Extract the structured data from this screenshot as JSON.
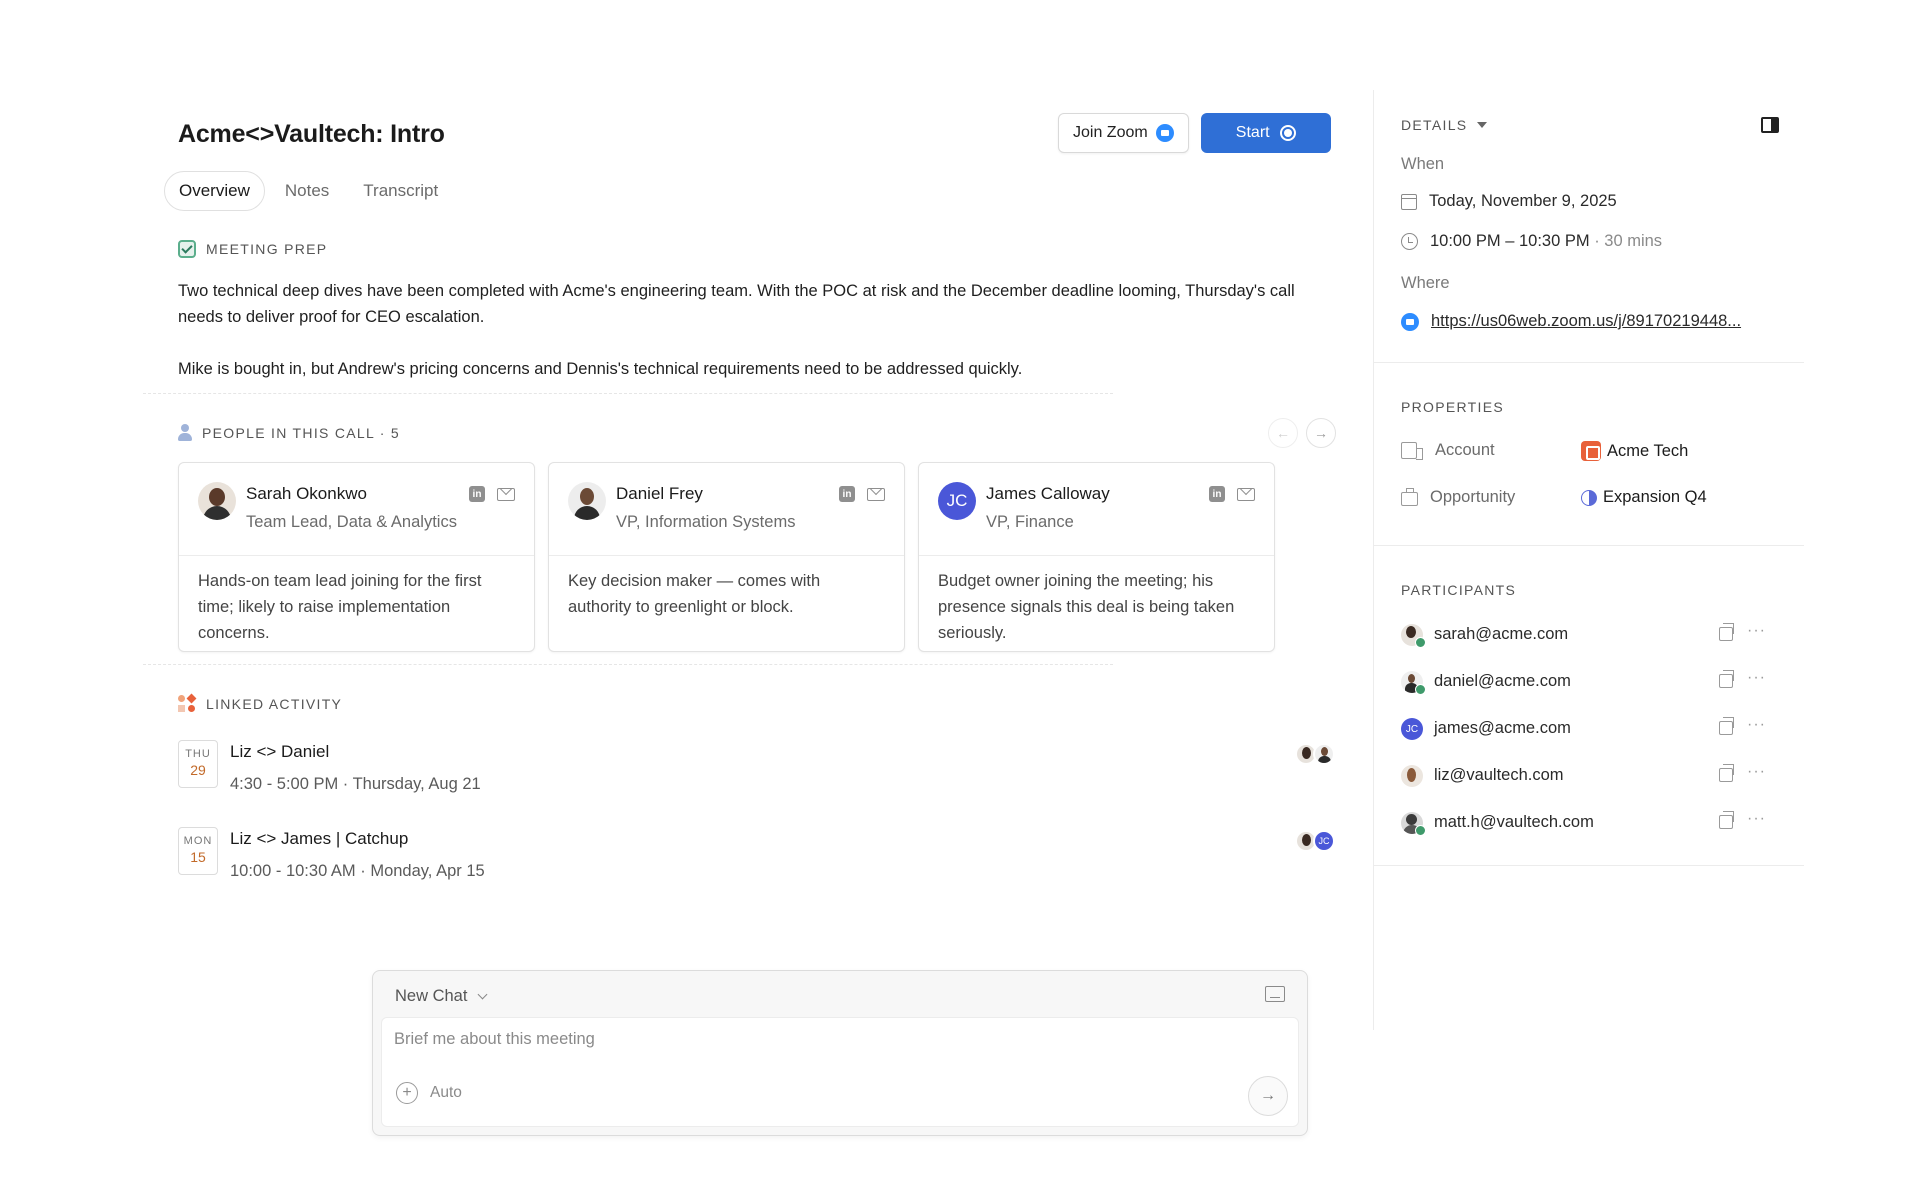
{
  "header": {
    "title": "Acme<>Vaultech: Intro",
    "join_zoom_label": "Join Zoom",
    "start_label": "Start"
  },
  "tabs": [
    {
      "label": "Overview",
      "active": true
    },
    {
      "label": "Notes",
      "active": false
    },
    {
      "label": "Transcript",
      "active": false
    }
  ],
  "meeting_prep": {
    "heading": "MEETING PREP",
    "paragraphs": [
      "Two technical deep dives have been completed with Acme's engineering team. With the POC at risk and the December deadline looming, Thursday's call needs to deliver proof for CEO escalation.",
      "Mike is bought in, but Andrew's pricing concerns and Dennis's technical requirements need to be addressed quickly."
    ]
  },
  "people": {
    "heading": "PEOPLE IN THIS CALL · 5",
    "cards": [
      {
        "name": "Sarah Okonkwo",
        "role": "Team Lead, Data & Analytics",
        "description": "Hands-on team lead joining for the first time; likely to raise implementation concerns."
      },
      {
        "name": "Daniel Frey",
        "role": "VP, Information Systems",
        "description": "Key decision maker — comes with authority to greenlight or block."
      },
      {
        "name": "James Calloway",
        "role": "VP, Finance",
        "initials": "JC",
        "description": "Budget owner joining the meeting; his presence signals this deal is being taken seriously."
      }
    ]
  },
  "linked_activity": {
    "heading": "LINKED ACTIVITY",
    "items": [
      {
        "dow": "THU",
        "day": "29",
        "title": "Liz <> Daniel",
        "time": "4:30 - 5:00 PM · Thursday, Aug 21"
      },
      {
        "dow": "MON",
        "day": "15",
        "title": "Liz <> James | Catchup",
        "time": "10:00 - 10:30 AM · Monday, Apr 15",
        "avatar_initials": "JC"
      }
    ]
  },
  "chat": {
    "title": "New Chat",
    "placeholder": "Brief me about this meeting",
    "mode": "Auto"
  },
  "sidebar": {
    "details_heading": "DETAILS",
    "when_label": "When",
    "date": "Today, November 9, 2025",
    "time": "10:00 PM – 10:30 PM",
    "duration": " · 30 mins",
    "where_label": "Where",
    "zoom_link": "https://us06web.zoom.us/j/89170219448...",
    "properties_heading": "PROPERTIES",
    "account_label": "Account",
    "account_value": "Acme Tech",
    "opportunity_label": "Opportunity",
    "opportunity_value": "Expansion Q4",
    "participants_heading": "PARTICIPANTS",
    "participants": [
      {
        "email": "sarah@acme.com"
      },
      {
        "email": "daniel@acme.com"
      },
      {
        "email": "james@acme.com",
        "initials": "JC"
      },
      {
        "email": "liz@vaultech.com"
      },
      {
        "email": "matt.h@vaultech.com"
      }
    ]
  }
}
